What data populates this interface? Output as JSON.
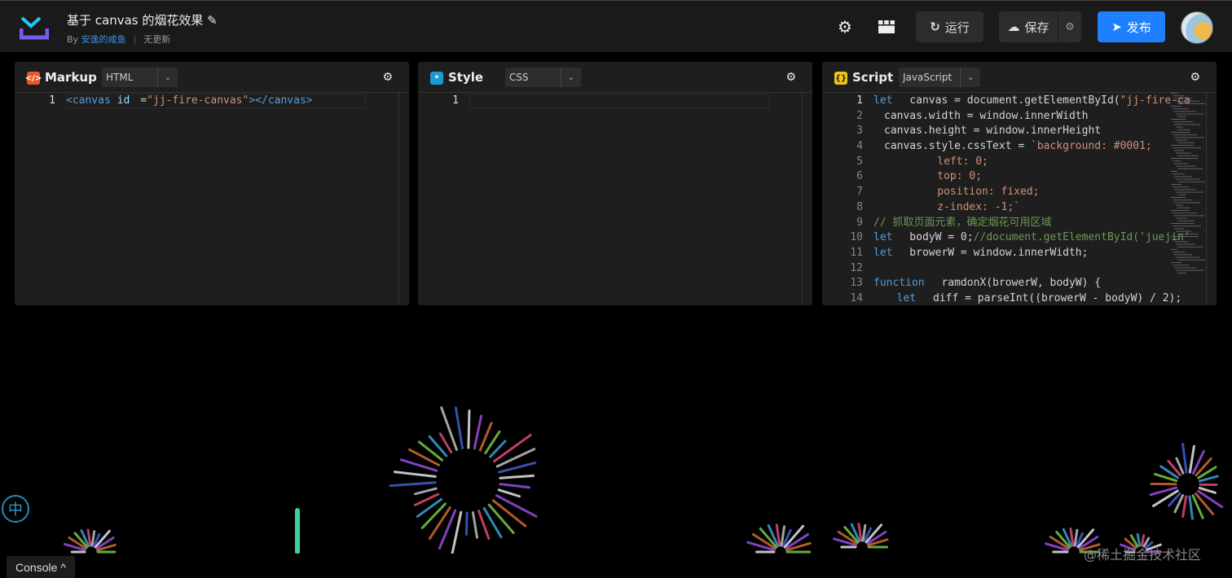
{
  "header": {
    "title": "基于 canvas 的烟花效果",
    "by": "By",
    "author": "安逸的咸鱼",
    "status": "无更新",
    "run_label": "运行",
    "save_label": "保存",
    "publish_label": "发布",
    "icons": [
      "settings-icon",
      "layout-icon",
      "refresh-icon",
      "cloud-upload-icon",
      "gear-icon",
      "send-icon"
    ]
  },
  "panels": [
    {
      "name": "Markup",
      "lang": "HTML",
      "badge": "</>",
      "color": "#e8592a",
      "lines": [
        [
          [
            "tag",
            "<canvas "
          ],
          [
            "attr",
            "id"
          ],
          [
            "txt",
            "="
          ],
          [
            "str",
            "\"jj-fire-canvas\""
          ],
          [
            "tag",
            "></canvas>"
          ]
        ]
      ]
    },
    {
      "name": "Style",
      "lang": "CSS",
      "badge": "*",
      "color": "#1a9bd6",
      "lines": [
        []
      ]
    },
    {
      "name": "Script",
      "lang": "JavaScript",
      "badge": "{}",
      "color": "#f0c419",
      "lines": [
        [
          [
            "kw",
            "let"
          ],
          [
            "txt",
            " canvas = document.getElementById("
          ],
          [
            "str",
            "\"jj-fire-ca"
          ]
        ],
        [
          [
            "txt",
            "canvas.width = window.innerWidth"
          ]
        ],
        [
          [
            "txt",
            "canvas.height = window.innerHeight"
          ]
        ],
        [
          [
            "txt",
            "canvas.style.cssText = "
          ],
          [
            "str",
            "`background: #0001;"
          ]
        ],
        [
          [
            "str",
            "          left: 0;"
          ]
        ],
        [
          [
            "str",
            "          top: 0;"
          ]
        ],
        [
          [
            "str",
            "          position: fixed;"
          ]
        ],
        [
          [
            "str",
            "          z-index: -1;`"
          ]
        ],
        [
          [
            "cm",
            "// 抓取页面元素，确定烟花可用区域"
          ]
        ],
        [
          [
            "kw",
            "let"
          ],
          [
            "txt",
            " bodyW = 0;"
          ],
          [
            "cm",
            "//document.getElementById('juejin'"
          ]
        ],
        [
          [
            "kw",
            "let"
          ],
          [
            "txt",
            " browerW = window.innerWidth;"
          ]
        ],
        [],
        [
          [
            "kw",
            "function"
          ],
          [
            "txt",
            " ramdonX(browerW, bodyW) {"
          ]
        ],
        [
          [
            "txt",
            "  "
          ],
          [
            "kw",
            "let"
          ],
          [
            "txt",
            " diff = parseInt((browerW - bodyW) / 2);"
          ]
        ]
      ]
    }
  ],
  "footer": {
    "console_label": "Console",
    "ime_label": "中",
    "watermark": "@稀土掘金技术社区"
  },
  "colors": {
    "accent": "#1e80ff",
    "header_bg": "#1a1a1a",
    "panel_bg": "#1e1e1e"
  }
}
